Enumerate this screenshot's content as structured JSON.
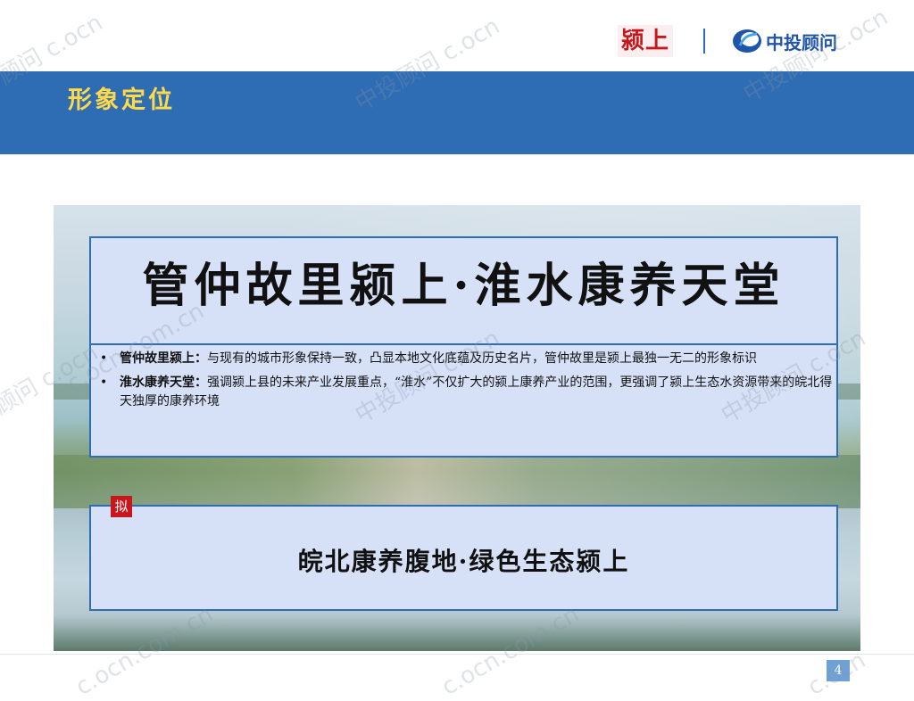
{
  "header": {
    "client_logo_text": "颍上",
    "company_name": "中投顾问",
    "section_title": "形象定位"
  },
  "main": {
    "slogan": "管仲故里颍上·淮水康养天堂",
    "bullets": [
      {
        "marker": "•",
        "term": "管仲故里颍上",
        "separator": "：",
        "text": "与现有的城市形象保持一致，凸显本地文化底蕴及历史名片，管仲故里是颍上最独一无二的形象标识"
      },
      {
        "marker": "•",
        "term": "淮水康养天堂",
        "separator": "：",
        "text": "强调颍上县的未来产业发展重点，“淮水”不仅扩大的颍上康养产业的范围，更强调了颍上生态水资源带来的皖北得天独厚的康养环境"
      }
    ],
    "proposed": {
      "badge": "拟",
      "text": "皖北康养腹地·绿色生态颍上"
    }
  },
  "footer": {
    "page_number": "4"
  },
  "watermarks": [
    "顾问 c.ocn",
    "中投顾问 c.ocn",
    "中投顾问 c.ocn",
    "c.ocn.com.cn",
    "顾问 c.ocn",
    "中投顾问 c.ocn",
    "中投顾问 c.ocn",
    "c.ocn.com.cn",
    "c.ocn.com.cn",
    "c.ocn"
  ],
  "colors": {
    "header_band": "#2e6db3",
    "title_gold": "#ffd94a",
    "box_fill": "#d6e0f7",
    "box_border": "#2e6db3",
    "logo_red": "#c8161d",
    "logo_blue": "#1f55a8"
  }
}
